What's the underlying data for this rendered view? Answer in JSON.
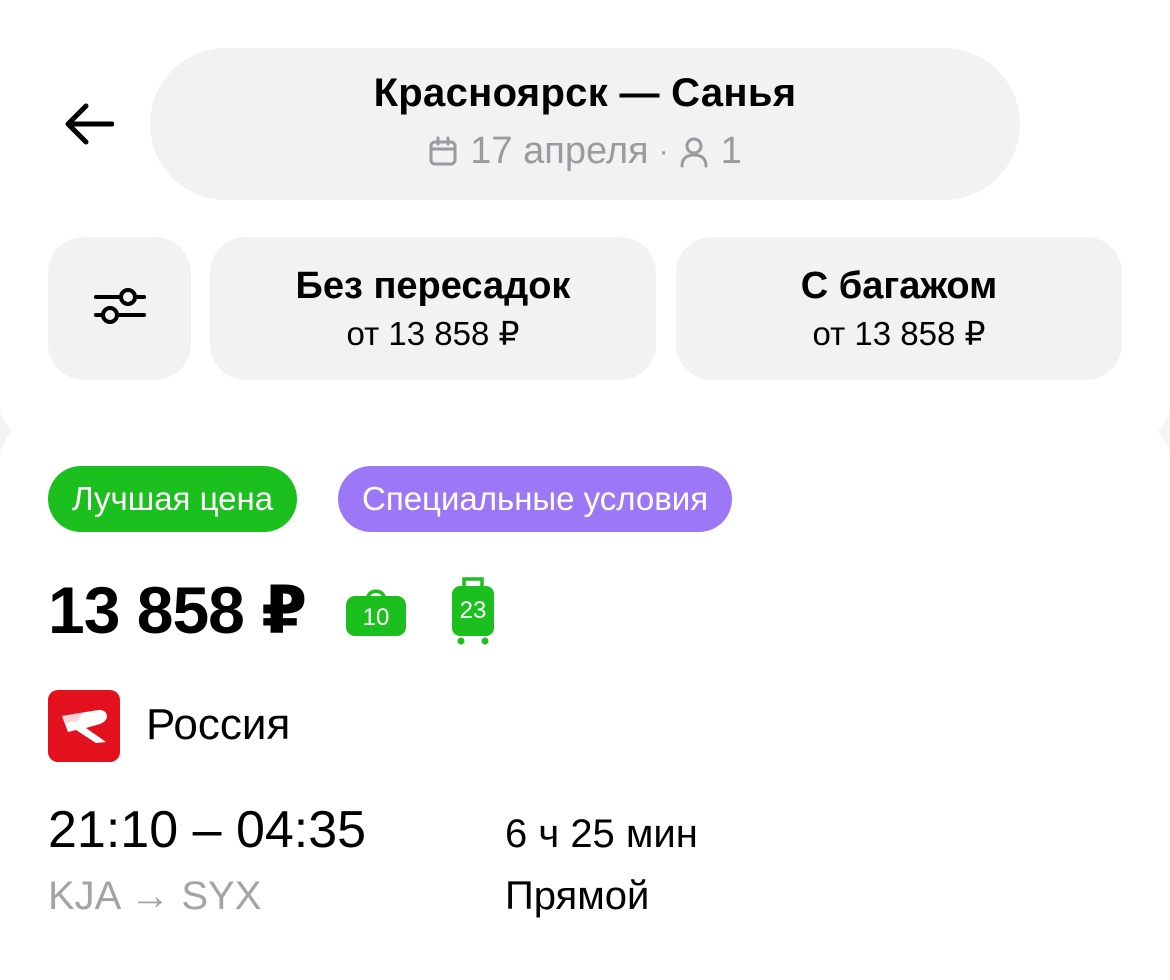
{
  "header": {
    "back_icon": "arrow-left-icon",
    "route": "Красноярск — Санья",
    "date": "17 апреля",
    "passengers": "1",
    "separator": "·",
    "calendar_icon": "calendar-icon",
    "person_icon": "person-icon"
  },
  "filters": {
    "settings_icon": "sliders-icon",
    "chips": [
      {
        "title": "Без пересадок",
        "price": "от 13 858 ₽"
      },
      {
        "title": "С багажом",
        "price": "от 13 858 ₽"
      }
    ]
  },
  "offer": {
    "badges": [
      {
        "label": "Лучшая цена",
        "color": "#1bbf1e"
      },
      {
        "label": "Специальные условия",
        "color": "#9c78f6"
      }
    ],
    "price": "13 858 ₽",
    "hand_luggage": "10",
    "baggage": "23",
    "luggage_color": "#1bbf1e",
    "airline": {
      "name": "Россия",
      "logo_color": "#e3101e"
    },
    "times": "21:10 – 04:35",
    "route_codes": "KJA → SYX",
    "duration": "6 ч 25 мин",
    "stops": "Прямой"
  }
}
